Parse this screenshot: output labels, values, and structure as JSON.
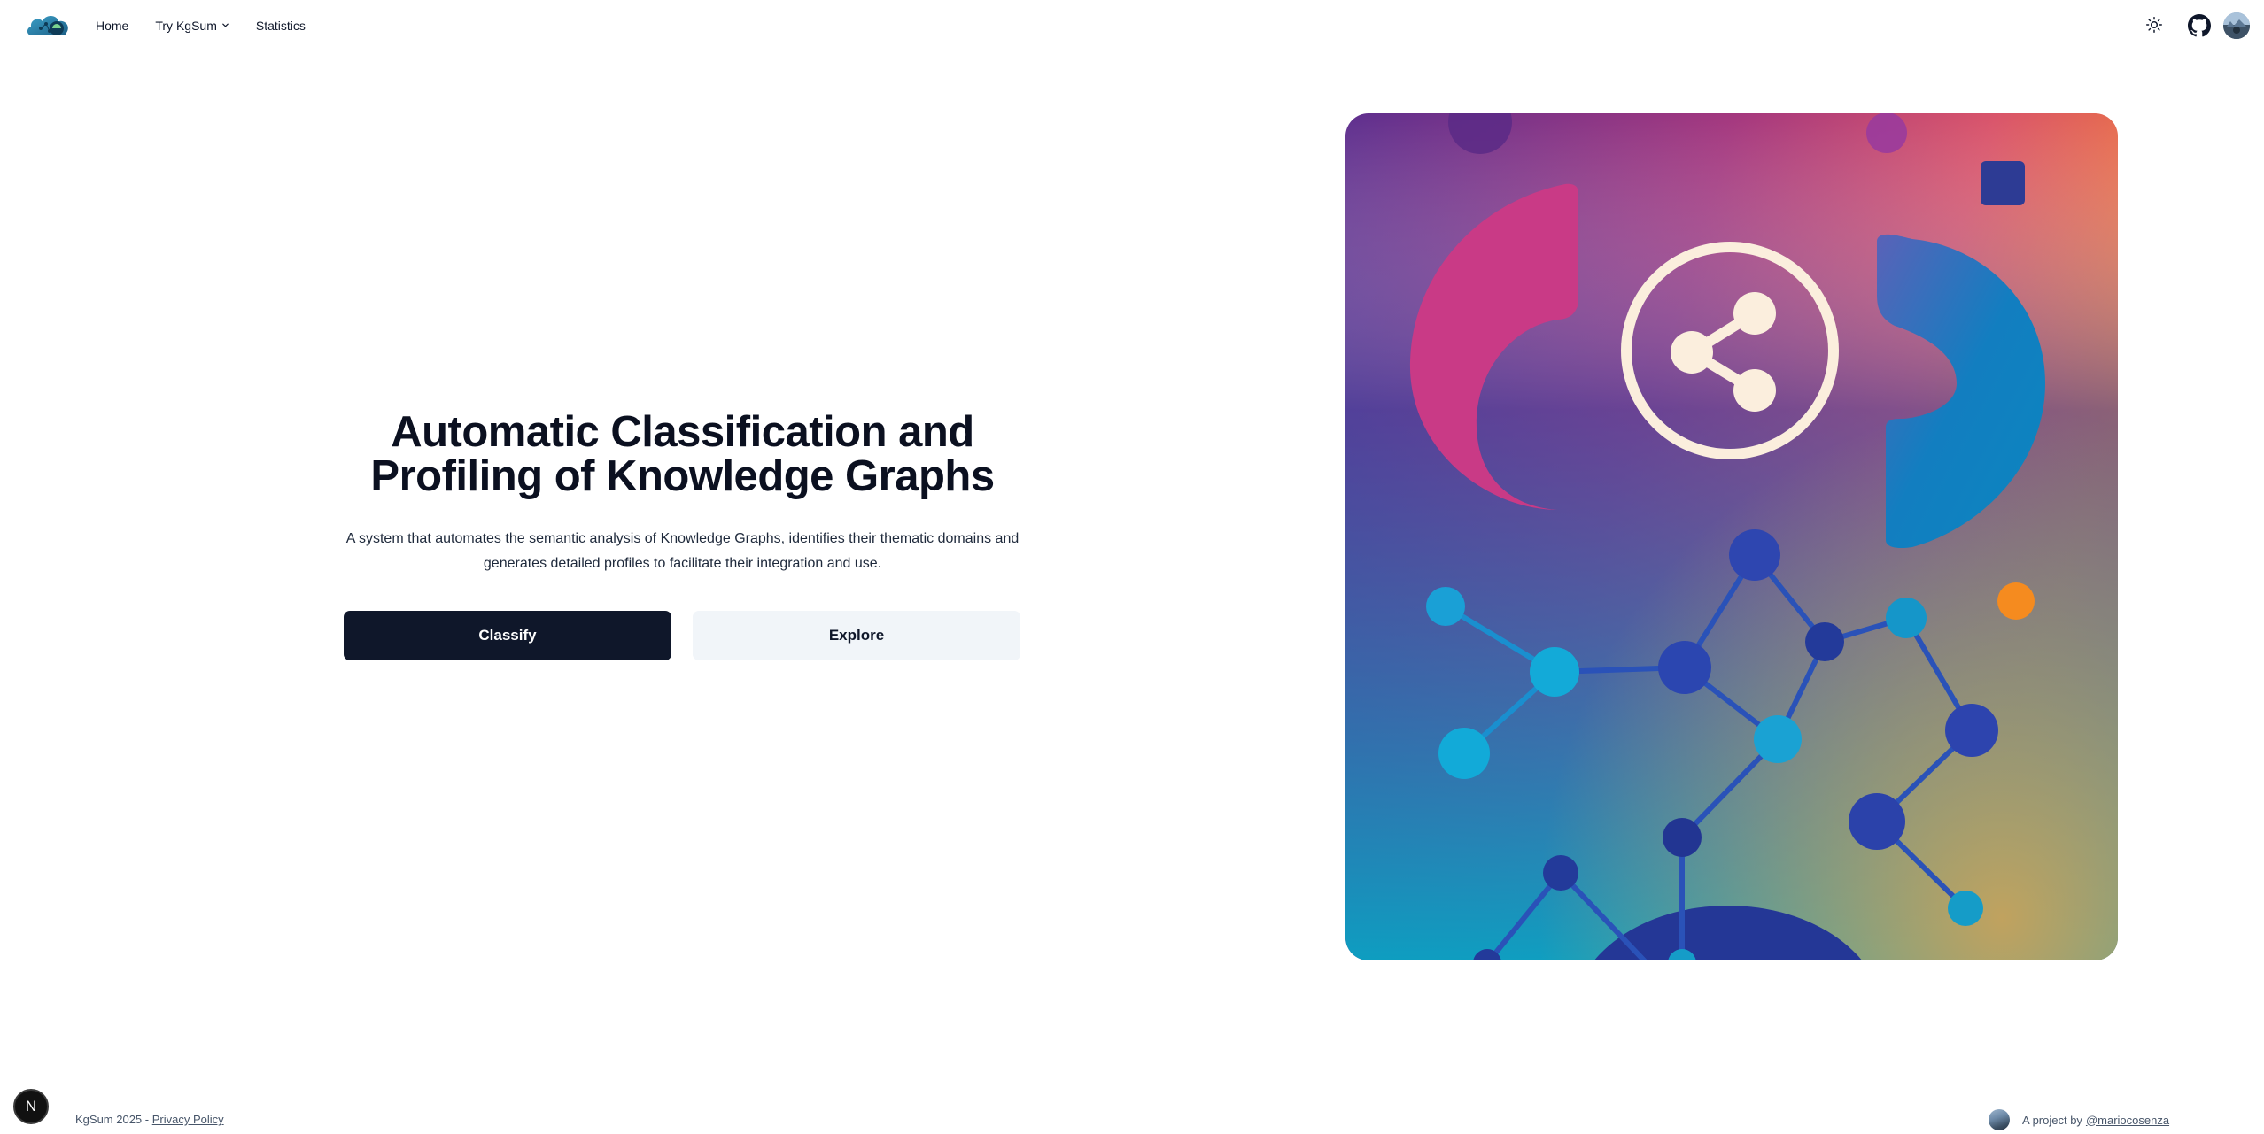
{
  "nav": {
    "links": [
      {
        "label": "Home"
      },
      {
        "label": "Try KgSum"
      },
      {
        "label": "Statistics"
      }
    ]
  },
  "hero": {
    "title_line1": "Automatic Classification and",
    "title_line2": "Profiling of Knowledge Graphs",
    "subtitle_line1": "A system that automates the semantic analysis of Knowledge Graphs, identifies their thematic domains and",
    "subtitle_line2": "generates detailed profiles to facilitate their integration and use.",
    "primary_button": "Classify",
    "secondary_button": "Explore"
  },
  "footer": {
    "copyright": "KgSum 2025 - ",
    "privacy_link": "Privacy Policy",
    "project_text": "A project by",
    "author_link": "@mariocosenza"
  },
  "badge": {
    "letter": "N"
  },
  "colors": {
    "primary": "#0f172a",
    "secondary_bg": "#f1f5f9",
    "illustration_cream": "#fbeedd"
  },
  "icons": {
    "theme_toggle": "sun-icon",
    "github": "github-icon",
    "share": "share-icon"
  }
}
